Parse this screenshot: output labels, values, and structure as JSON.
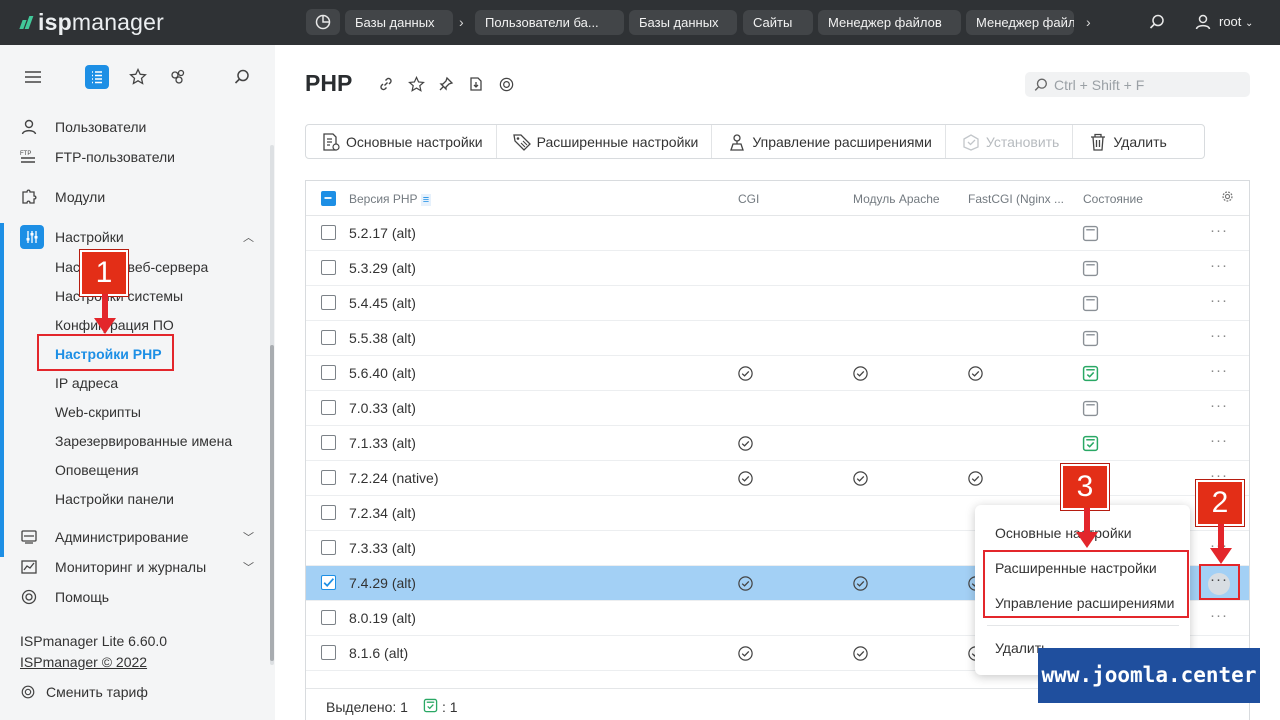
{
  "app": {
    "logo_prefix": "isp",
    "logo_suffix": "manager"
  },
  "topbar": {
    "breadcrumbs": [
      "Базы данных",
      "Пользователи ба...",
      "Базы данных",
      "Сайты",
      "Менеджер файлов",
      "Менеджер файл"
    ],
    "user": "root"
  },
  "sidebar": {
    "items": [
      {
        "label": "Пользователи",
        "icon": "user-icon"
      },
      {
        "label": "FTP-пользователи",
        "icon": "ftp-icon"
      },
      {
        "label": "Модули",
        "icon": "puzzle-icon"
      },
      {
        "label": "Настройки",
        "icon": "sliders-icon"
      },
      {
        "label": "Администрирование",
        "icon": "server-icon"
      },
      {
        "label": "Мониторинг и журналы",
        "icon": "chart-icon"
      },
      {
        "label": "Помощь",
        "icon": "lifebuoy-icon"
      }
    ],
    "subitems": [
      "Настройки веб-сервера",
      "Настройки системы",
      "Конфигурация ПО",
      "Настройки PHP",
      "IP адреса",
      "Web-скрипты",
      "Зарезервированные имена",
      "Оповещения",
      "Настройки панели"
    ],
    "version": "ISPmanager Lite 6.60.0",
    "copyright": "ISPmanager © 2022",
    "change_tariff": "Сменить тариф"
  },
  "page": {
    "title": "PHP",
    "search_placeholder": "Ctrl + Shift + F"
  },
  "toolbar": {
    "main_settings": "Основные настройки",
    "advanced_settings": "Расширенные настройки",
    "manage_extensions": "Управление расширениями",
    "install": "Установить",
    "delete": "Удалить"
  },
  "table": {
    "columns": [
      "Версия PHP",
      "CGI",
      "Модуль Apache",
      "FastCGI (Nginx ...",
      "Состояние"
    ],
    "rows": [
      {
        "version": "5.2.17 (alt)",
        "cgi": false,
        "apache": false,
        "fastcgi": false,
        "state": "off"
      },
      {
        "version": "5.3.29 (alt)",
        "cgi": false,
        "apache": false,
        "fastcgi": false,
        "state": "off"
      },
      {
        "version": "5.4.45 (alt)",
        "cgi": false,
        "apache": false,
        "fastcgi": false,
        "state": "off"
      },
      {
        "version": "5.5.38 (alt)",
        "cgi": false,
        "apache": false,
        "fastcgi": false,
        "state": "off"
      },
      {
        "version": "5.6.40 (alt)",
        "cgi": true,
        "apache": true,
        "fastcgi": true,
        "state": "on"
      },
      {
        "version": "7.0.33 (alt)",
        "cgi": false,
        "apache": false,
        "fastcgi": false,
        "state": "off"
      },
      {
        "version": "7.1.33 (alt)",
        "cgi": true,
        "apache": false,
        "fastcgi": false,
        "state": "on"
      },
      {
        "version": "7.2.24 (native)",
        "cgi": true,
        "apache": true,
        "fastcgi": true,
        "state": "hidden"
      },
      {
        "version": "7.2.34 (alt)",
        "cgi": false,
        "apache": false,
        "fastcgi": false,
        "state": "hidden"
      },
      {
        "version": "7.3.33 (alt)",
        "cgi": false,
        "apache": false,
        "fastcgi": false,
        "state": "hidden"
      },
      {
        "version": "7.4.29 (alt)",
        "cgi": true,
        "apache": true,
        "fastcgi": true,
        "state": "hidden",
        "selected": true
      },
      {
        "version": "8.0.19 (alt)",
        "cgi": false,
        "apache": false,
        "fastcgi": false,
        "state": "hidden"
      },
      {
        "version": "8.1.6 (alt)",
        "cgi": true,
        "apache": true,
        "fastcgi": true,
        "state": "hidden"
      }
    ],
    "footer_label": "Выделено: 1",
    "footer_count": ": 1"
  },
  "context_menu": {
    "items": [
      "Основные настройки",
      "Расширенные настройки",
      "Управление расширениями",
      "Удалить"
    ]
  },
  "annotations": [
    "1",
    "2",
    "3"
  ],
  "watermark": "www.joomla.center",
  "colors": {
    "accent": "#1d8fe5",
    "topbar": "#2f3235",
    "annotation": "#e3262b",
    "ok": "#2aa865"
  }
}
